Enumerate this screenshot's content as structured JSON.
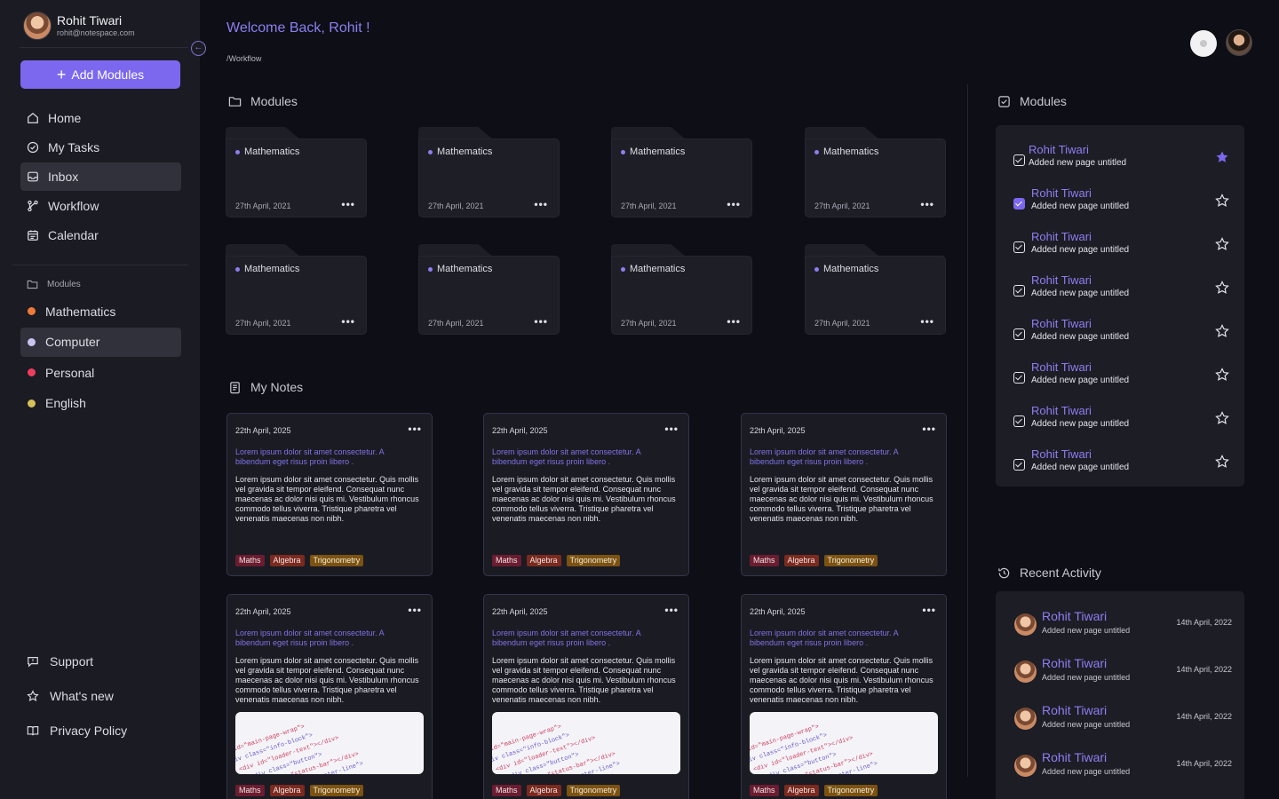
{
  "user": {
    "name": "Rohit Tiwari",
    "email": "rohit@notespace.com"
  },
  "sidebar": {
    "add_label": "Add Modules",
    "nav": [
      {
        "label": "Home",
        "icon": "home-icon"
      },
      {
        "label": "My Tasks",
        "icon": "check-circle-icon"
      },
      {
        "label": "Inbox",
        "icon": "inbox-icon",
        "active": true
      },
      {
        "label": "Workflow",
        "icon": "workflow-icon"
      },
      {
        "label": "Calendar",
        "icon": "calendar-icon"
      }
    ],
    "modules_label": "Modules",
    "modules": [
      {
        "label": "Mathematics",
        "color": "#f07a3c"
      },
      {
        "label": "Computer",
        "color": "#c9c4ef",
        "active": true
      },
      {
        "label": "Personal",
        "color": "#ee3e5c"
      },
      {
        "label": "English",
        "color": "#d6c05a"
      }
    ],
    "footer": [
      {
        "label": "Support",
        "icon": "support-icon"
      },
      {
        "label": "What's new",
        "icon": "star-icon"
      },
      {
        "label": "Privacy Policy",
        "icon": "book-icon"
      }
    ]
  },
  "header": {
    "welcome": "Welcome Back, Rohit !",
    "breadcrumb": "/Workflow"
  },
  "modules_section": {
    "title": "Modules",
    "cards": [
      {
        "label": "Mathematics",
        "date": "27th April, 2021"
      },
      {
        "label": "Mathematics",
        "date": "27th April, 2021"
      },
      {
        "label": "Mathematics",
        "date": "27th April, 2021"
      },
      {
        "label": "Mathematics",
        "date": "27th April, 2021"
      },
      {
        "label": "Mathematics",
        "date": "27th April, 2021"
      },
      {
        "label": "Mathematics",
        "date": "27th April, 2021"
      },
      {
        "label": "Mathematics",
        "date": "27th April, 2021"
      },
      {
        "label": "Mathematics",
        "date": "27th April, 2021"
      }
    ]
  },
  "notes_section": {
    "title": "My Notes",
    "notes": [
      {
        "date": "22th April, 2025",
        "lead": "Lorem ipsum dolor sit amet consectetur. A bibendum eget risus proin libero .",
        "body": "Lorem ipsum dolor sit amet consectetur. Quis mollis vel gravida sit tempor eleifend. Consequat nunc maecenas ac dolor nisi quis mi. Vestibulum rhoncus commodo tellus viverra. Tristique pharetra vel venenatis maecenas non nibh.",
        "tags": [
          "Maths",
          "Algebra",
          "Trigonometry"
        ],
        "has_image": false
      },
      {
        "date": "22th April, 2025",
        "lead": "Lorem ipsum dolor sit amet consectetur. A bibendum eget risus proin libero .",
        "body": "Lorem ipsum dolor sit amet consectetur. Quis mollis vel gravida sit tempor eleifend. Consequat nunc maecenas ac dolor nisi quis mi. Vestibulum rhoncus commodo tellus viverra. Tristique pharetra vel venenatis maecenas non nibh.",
        "tags": [
          "Maths",
          "Algebra",
          "Trigonometry"
        ],
        "has_image": false
      },
      {
        "date": "22th April, 2025",
        "lead": "Lorem ipsum dolor sit amet consectetur. A bibendum eget risus proin libero .",
        "body": "Lorem ipsum dolor sit amet consectetur. Quis mollis vel gravida sit tempor eleifend. Consequat nunc maecenas ac dolor nisi quis mi. Vestibulum rhoncus commodo tellus viverra. Tristique pharetra vel venenatis maecenas non nibh.",
        "tags": [
          "Maths",
          "Algebra",
          "Trigonometry"
        ],
        "has_image": false
      },
      {
        "date": "22th April, 2025",
        "lead": "Lorem ipsum dolor sit amet consectetur. A bibendum eget risus proin libero .",
        "body": "Lorem ipsum dolor sit amet consectetur. Quis mollis vel gravida sit tempor eleifend. Consequat nunc maecenas ac dolor nisi quis mi. Vestibulum rhoncus commodo tellus viverra. Tristique pharetra vel venenatis maecenas non nibh.",
        "tags": [
          "Maths",
          "Algebra",
          "Trigonometry"
        ],
        "has_image": true
      },
      {
        "date": "22th April, 2025",
        "lead": "Lorem ipsum dolor sit amet consectetur. A bibendum eget risus proin libero .",
        "body": "Lorem ipsum dolor sit amet consectetur. Quis mollis vel gravida sit tempor eleifend. Consequat nunc maecenas ac dolor nisi quis mi. Vestibulum rhoncus commodo tellus viverra. Tristique pharetra vel venenatis maecenas non nibh.",
        "tags": [
          "Maths",
          "Algebra",
          "Trigonometry"
        ],
        "has_image": true
      },
      {
        "date": "22th April, 2025",
        "lead": "Lorem ipsum dolor sit amet consectetur. A bibendum eget risus proin libero .",
        "body": "Lorem ipsum dolor sit amet consectetur. Quis mollis vel gravida sit tempor eleifend. Consequat nunc maecenas ac dolor nisi quis mi. Vestibulum rhoncus commodo tellus viverra. Tristique pharetra vel venenatis maecenas non nibh.",
        "tags": [
          "Maths",
          "Algebra",
          "Trigonometry"
        ],
        "has_image": true
      }
    ]
  },
  "right_modules": {
    "title": "Modules",
    "items": [
      {
        "name": "Rohit Tiwari",
        "sub": "Added new page untitled",
        "checked": false,
        "starred": true
      },
      {
        "name": "Rohit Tiwari",
        "sub": "Added new page untitled",
        "checked": true,
        "starred": false
      },
      {
        "name": "Rohit Tiwari",
        "sub": "Added new page untitled",
        "checked": false,
        "starred": false
      },
      {
        "name": "Rohit Tiwari",
        "sub": "Added new page untitled",
        "checked": false,
        "starred": false
      },
      {
        "name": "Rohit Tiwari",
        "sub": "Added new page untitled",
        "checked": false,
        "starred": false
      },
      {
        "name": "Rohit Tiwari",
        "sub": "Added new page untitled",
        "checked": false,
        "starred": false
      },
      {
        "name": "Rohit Tiwari",
        "sub": "Added new page untitled",
        "checked": false,
        "starred": false
      },
      {
        "name": "Rohit Tiwari",
        "sub": "Added new page untitled",
        "checked": false,
        "starred": false
      }
    ]
  },
  "recent_activity": {
    "title": "Recent Activity",
    "items": [
      {
        "name": "Rohit Tiwari",
        "sub": "Added new page untitled",
        "date": "14th April, 2022"
      },
      {
        "name": "Rohit Tiwari",
        "sub": "Added new page untitled",
        "date": "14th April, 2022"
      },
      {
        "name": "Rohit Tiwari",
        "sub": "Added new page untitled",
        "date": "14th April, 2022"
      },
      {
        "name": "Rohit Tiwari",
        "sub": "Added new page untitled",
        "date": "14th April, 2022"
      }
    ]
  },
  "colors": {
    "accent": "#7b68ee",
    "accent_text": "#8b7ff0",
    "background": "#0e0e16",
    "sidebar": "#1b1b23"
  }
}
